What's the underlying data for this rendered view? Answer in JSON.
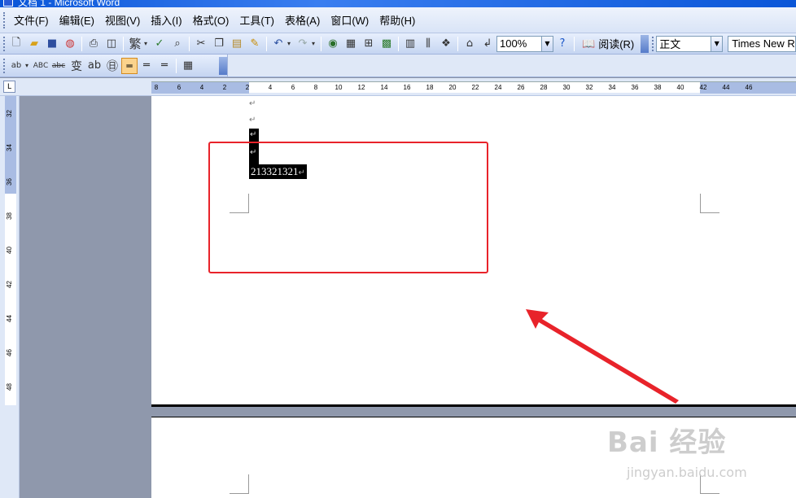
{
  "window": {
    "title": "文档 1 - Microsoft Word"
  },
  "menu": [
    "文件(F)",
    "编辑(E)",
    "视图(V)",
    "插入(I)",
    "格式(O)",
    "工具(T)",
    "表格(A)",
    "窗口(W)",
    "帮助(H)"
  ],
  "toolbar": {
    "zoom": "100%",
    "read_label": "阅读(R)",
    "style": "正文",
    "font": "Times New R"
  },
  "icons": {
    "new": "new-doc-icon",
    "open": "open-icon",
    "save": "save-icon",
    "permission": "permission-icon",
    "print": "print-icon",
    "preview": "print-preview-icon",
    "trad_chinese": "traditional-chinese-icon",
    "spell": "spellcheck-icon",
    "research": "research-icon",
    "cut": "cut-icon",
    "copy": "copy-icon",
    "paste": "paste-icon",
    "format_painter": "format-painter-icon",
    "undo": "undo-icon",
    "redo": "redo-icon",
    "hyperlink": "hyperlink-icon",
    "tables_borders": "tables-borders-icon",
    "insert_table": "insert-table-icon",
    "insert_excel": "insert-excel-icon",
    "columns": "columns-icon",
    "drawing": "drawing-icon",
    "doc_map": "document-map-icon",
    "show_hide": "show-hide-icon",
    "help": "help-icon"
  },
  "ruler": {
    "h_ticks": [
      "8",
      "6",
      "4",
      "2",
      "2",
      "4",
      "6",
      "8",
      "10",
      "12",
      "14",
      "16",
      "18",
      "20",
      "22",
      "24",
      "26",
      "28",
      "30",
      "32",
      "34",
      "36",
      "38",
      "40",
      "42",
      "44",
      "46"
    ],
    "v_ticks": [
      "32",
      "34",
      "36",
      "38",
      "40",
      "42",
      "44",
      "46",
      "48"
    ]
  },
  "document": {
    "selected_text": "213321321",
    "paragraph_mark": "↵"
  },
  "colors": {
    "highlight_box": "#e8232a",
    "arrow": "#e8232a"
  },
  "watermark": {
    "brand": "Bai 经验",
    "site": "jingyan.baidu.com"
  }
}
